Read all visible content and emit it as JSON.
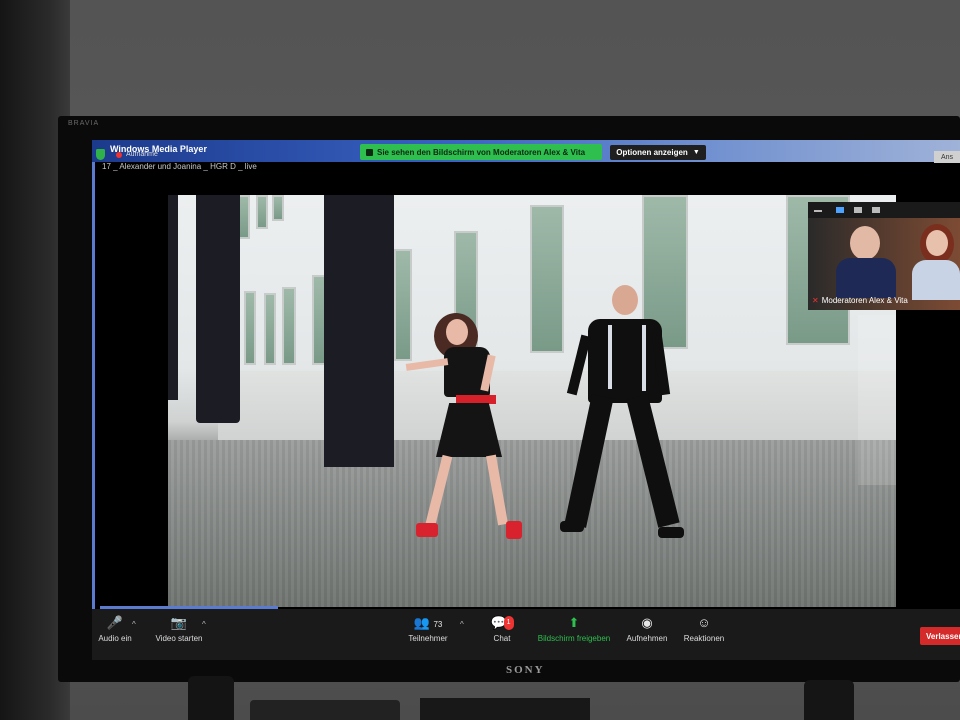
{
  "tv": {
    "brand_top": "BRAVIA",
    "brand_bottom": "SONY"
  },
  "player": {
    "title": "Windows Media Player",
    "recording_label": "Aufnahme",
    "file_name": "17 _ Alexander und Joanina _ HGR D _ live"
  },
  "share_banner": {
    "text": "Sie sehen den Bildschirm von Moderatoren Alex & Vita"
  },
  "options_button": {
    "label": "Optionen anzeigen"
  },
  "view_button": {
    "label": "Ans"
  },
  "participant_thumb": {
    "name": "Moderatoren Alex & Vita"
  },
  "toolbar": {
    "audio_label": "Audio ein",
    "video_label": "Video starten",
    "participants_label": "Teilnehmer",
    "participants_count": "73",
    "chat_label": "Chat",
    "chat_badge": "1",
    "share_label": "Bildschirm freigeben",
    "record_label": "Aufnehmen",
    "reactions_label": "Reaktionen",
    "leave_label": "Verlassen"
  },
  "colors": {
    "share_green": "#2fbf4f",
    "leave_red": "#d52a2a",
    "accent_blue": "#5b7bd1"
  },
  "icons": [
    "shield-icon",
    "microphone-muted-icon",
    "camera-muted-icon",
    "participants-icon",
    "chat-icon",
    "share-screen-icon",
    "record-icon",
    "reactions-icon"
  ]
}
